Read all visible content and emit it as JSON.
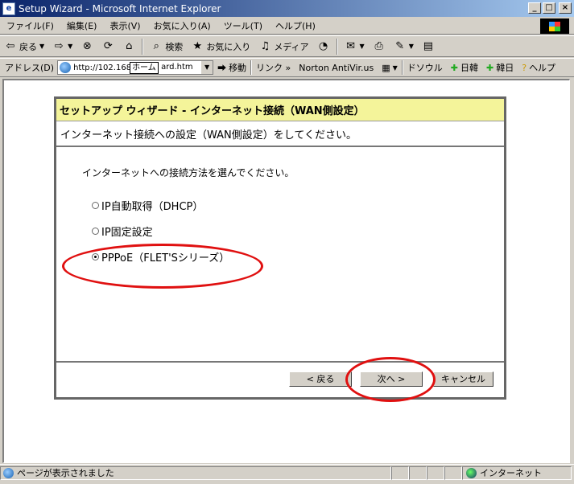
{
  "window": {
    "title": "Setup Wizard - Microsoft Internet Explorer"
  },
  "menu": [
    "ファイル(F)",
    "編集(E)",
    "表示(V)",
    "お気に入り(A)",
    "ツール(T)",
    "ヘルプ(H)"
  ],
  "toolbar": {
    "back": "戻る",
    "search": "検索",
    "favorites": "お気に入り",
    "media": "メディア"
  },
  "address": {
    "label": "アドレス(D)",
    "url_head": "http://102.168.",
    "tooltip": "ホーム",
    "url_tail": "ard.htm",
    "go": "移動",
    "links": "リンク »",
    "norton": "Norton AntiVir.us",
    "dosoul": "ドソウル",
    "nikkan1": "日韓",
    "nikkan2": "韓日",
    "help": "ヘルプ"
  },
  "wizard": {
    "header": "セットアップ ウィザード - インターネット接続（WAN側設定）",
    "subtitle": "インターネット接続への設定（WAN側設定）をしてください。",
    "prompt": "インターネットへの接続方法を選んでください。",
    "options": [
      {
        "label": "IP自動取得（DHCP）",
        "checked": false
      },
      {
        "label": "IP固定設定",
        "checked": false
      },
      {
        "label": "PPPoE（FLET'Sシリーズ）",
        "checked": true
      }
    ],
    "back_label": "< 戻る",
    "next_label": "次へ >",
    "cancel_label": "キャンセル"
  },
  "status": {
    "message": "ページが表示されました",
    "zone": "インターネット"
  },
  "colors": {
    "annotation": "#e01010",
    "wizard_header_bg": "#f4f49a",
    "titlebar": "#0a246a"
  }
}
